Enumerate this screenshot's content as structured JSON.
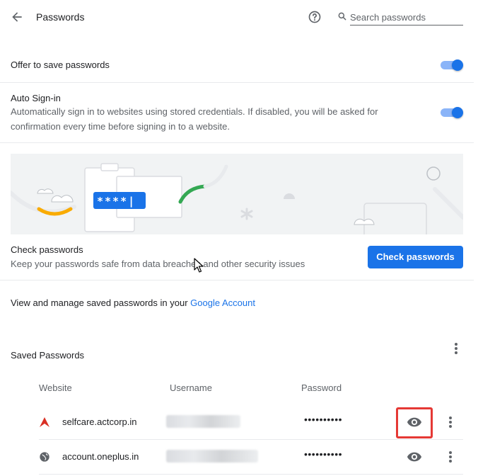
{
  "header": {
    "title": "Passwords",
    "search_placeholder": "Search passwords",
    "icons": {
      "back": "arrow-back-icon",
      "help": "help-circle-icon",
      "search": "search-icon"
    }
  },
  "settings": {
    "offer_to_save": {
      "label": "Offer to save passwords",
      "enabled": true
    },
    "auto_signin": {
      "label": "Auto Sign-in",
      "description_line1": "Automatically sign in to websites using stored credentials. If disabled, you will be asked for",
      "description_line2": "confirmation every time before signing in to a website.",
      "enabled": true
    }
  },
  "banner": {
    "password_mask": "****|"
  },
  "check_passwords": {
    "title": "Check passwords",
    "description": "Keep your passwords safe from data breaches and other security issues",
    "button_label": "Check passwords"
  },
  "account_link": {
    "prefix": "View and manage saved passwords in your ",
    "link_text": "Google Account"
  },
  "saved_passwords": {
    "title": "Saved Passwords",
    "columns": {
      "website": "Website",
      "username": "Username",
      "password": "Password"
    },
    "rows": [
      {
        "website": "selfcare.actcorp.in",
        "icon": "act-logo-icon",
        "username_hidden": true,
        "password": "••••••••••"
      },
      {
        "website": "account.oneplus.in",
        "icon": "globe-icon",
        "username_hidden": true,
        "password": "••••••••••"
      }
    ]
  },
  "colors": {
    "accent": "#1a73e8",
    "toggle_track": "#8ab4f8",
    "highlight": "#e53935",
    "text_primary": "#202124",
    "text_secondary": "#5f6368"
  }
}
